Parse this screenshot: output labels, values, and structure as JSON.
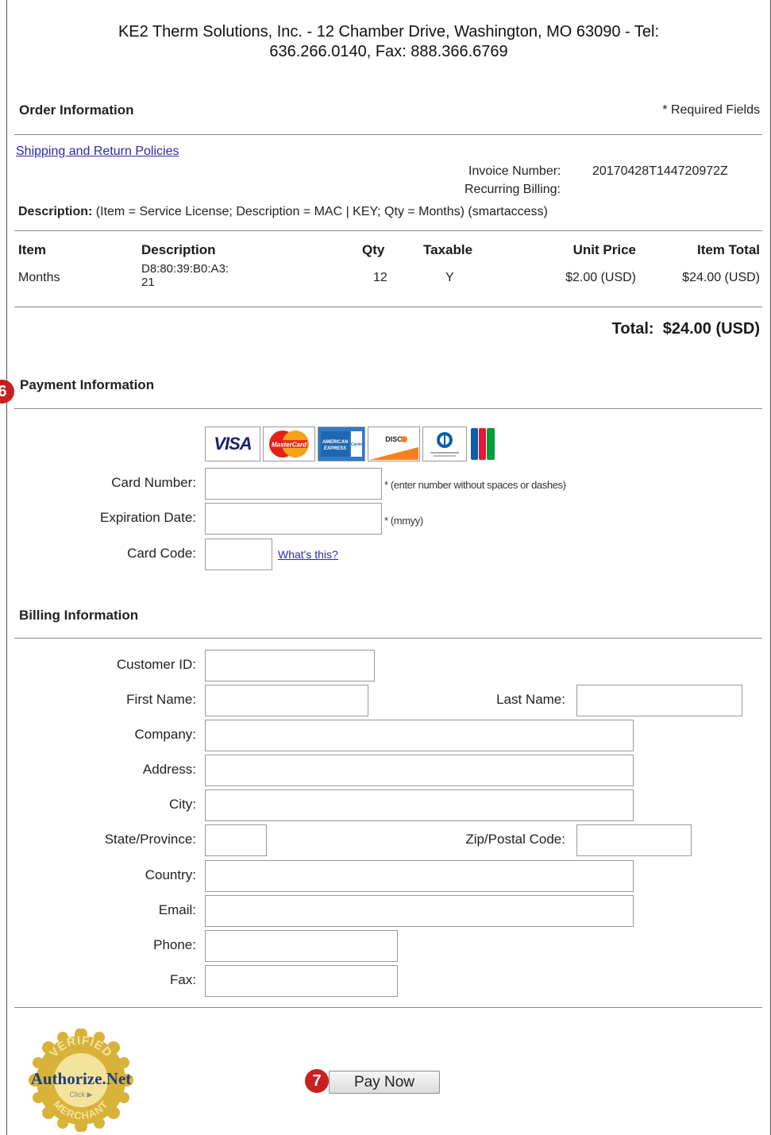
{
  "header": {
    "line1": "KE2 Therm Solutions, Inc. - 12 Chamber Drive, Washington, MO 63090 - Tel:",
    "line2": "636.266.0140, Fax: 888.366.6769"
  },
  "order": {
    "title": "Order Information",
    "required_note": "* Required Fields",
    "policies_link": "Shipping and Return Policies",
    "invoice_label": "Invoice Number:",
    "invoice_value": "20170428T144720972Z",
    "recurring_label": "Recurring Billing:",
    "description_label": "Description:",
    "description_value": "(Item = Service License; Description = MAC | KEY; Qty = Months) (smartaccess)",
    "columns": [
      "Item",
      "Description",
      "Qty",
      "Taxable",
      "Unit Price",
      "Item Total"
    ],
    "row": {
      "item": "Months",
      "description_1": "D8:80:39:B0:A3:",
      "description_2": "21",
      "qty": "12",
      "taxable": "Y",
      "unit_price": "$2.00 (USD)",
      "item_total": "$24.00 (USD)"
    },
    "total_label": "Total:",
    "total_value": "$24.00 (USD)"
  },
  "payment": {
    "step_badge": "6",
    "title": "Payment Information",
    "card_logos": [
      "VISA",
      "MasterCard",
      "American Express",
      "DISCOVER",
      "Diners Club",
      "JCB"
    ],
    "card_number_label": "Card Number:",
    "card_number_hint": "* (enter number without spaces or dashes)",
    "expiration_label": "Expiration Date:",
    "expiration_hint": "* (mmyy)",
    "card_code_label": "Card Code:",
    "whats_this": "What's this?"
  },
  "billing": {
    "title": "Billing Information",
    "customer_id_label": "Customer ID:",
    "first_name_label": "First Name:",
    "last_name_label": "Last Name:",
    "company_label": "Company:",
    "address_label": "Address:",
    "city_label": "City:",
    "state_label": "State/Province:",
    "zip_label": "Zip/Postal Code:",
    "country_label": "Country:",
    "email_label": "Email:",
    "phone_label": "Phone:",
    "fax_label": "Fax:"
  },
  "footer": {
    "seal_text": "Authorize.Net",
    "seal_top": "VERIFIED",
    "seal_bottom": "MERCHANT",
    "seal_click": "Click",
    "step_badge": "7",
    "pay_button": "Pay Now"
  },
  "colors": {
    "link": "#2a2ab0",
    "badge": "#c9201f",
    "seal_gold": "#d8b33a",
    "seal_text": "#1f3f7a"
  }
}
